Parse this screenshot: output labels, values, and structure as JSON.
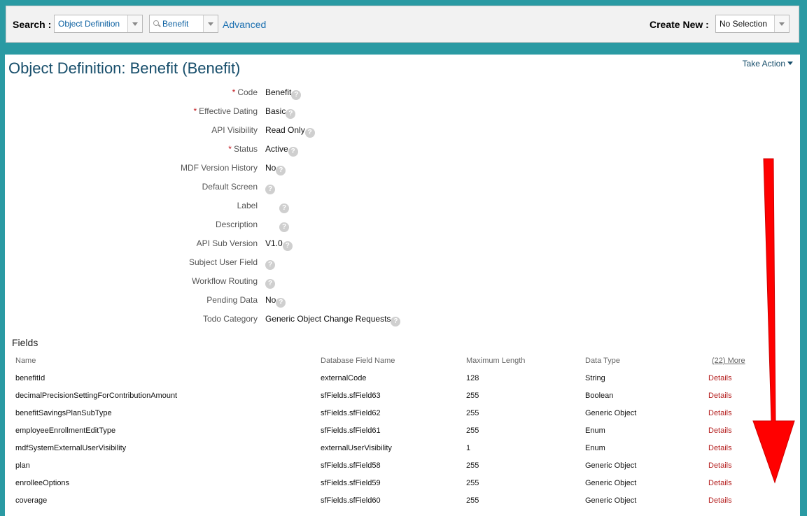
{
  "search": {
    "label": "Search :",
    "type_select": "Object Definition",
    "value_select": "Benefit",
    "advanced": "Advanced"
  },
  "create_new": {
    "label": "Create New :",
    "select": "No Selection"
  },
  "page": {
    "title": "Object Definition: Benefit (Benefit)",
    "take_action": "Take Action"
  },
  "properties": [
    {
      "label": "Code",
      "required": true,
      "value": "Benefit"
    },
    {
      "label": "Effective Dating",
      "required": true,
      "value": "Basic"
    },
    {
      "label": "API Visibility",
      "required": false,
      "value": "Read Only"
    },
    {
      "label": "Status",
      "required": true,
      "value": "Active"
    },
    {
      "label": "MDF Version History",
      "required": false,
      "value": "No"
    },
    {
      "label": "Default Screen",
      "required": false,
      "value": ""
    },
    {
      "label": "Label",
      "required": false,
      "value": ""
    },
    {
      "label": "Description",
      "required": false,
      "value": ""
    },
    {
      "label": "API Sub Version",
      "required": false,
      "value": "V1.0"
    },
    {
      "label": "Subject User Field",
      "required": false,
      "value": ""
    },
    {
      "label": "Workflow Routing",
      "required": false,
      "value": ""
    },
    {
      "label": "Pending Data",
      "required": false,
      "value": "No"
    },
    {
      "label": "Todo Category",
      "required": false,
      "value": "Generic Object Change Requests"
    }
  ],
  "fields": {
    "title": "Fields",
    "columns": [
      "Name",
      "Database Field Name",
      "Maximum Length",
      "Data Type"
    ],
    "more": "(22) More",
    "rows": [
      {
        "name": "benefitId",
        "db": "externalCode",
        "max": "128",
        "type": "String",
        "action": "Details"
      },
      {
        "name": "decimalPrecisionSettingForContributionAmount",
        "db": "sfFields.sfField63",
        "max": "255",
        "type": "Boolean",
        "action": "Details"
      },
      {
        "name": "benefitSavingsPlanSubType",
        "db": "sfFields.sfField62",
        "max": "255",
        "type": "Generic Object",
        "action": "Details"
      },
      {
        "name": "employeeEnrollmentEditType",
        "db": "sfFields.sfField61",
        "max": "255",
        "type": "Enum",
        "action": "Details"
      },
      {
        "name": "mdfSystemExternalUserVisibility",
        "db": "externalUserVisibility",
        "max": "1",
        "type": "Enum",
        "action": "Details"
      },
      {
        "name": "plan",
        "db": "sfFields.sfField58",
        "max": "255",
        "type": "Generic Object",
        "action": "Details"
      },
      {
        "name": "enrolleeOptions",
        "db": "sfFields.sfField59",
        "max": "255",
        "type": "Generic Object",
        "action": "Details"
      },
      {
        "name": "coverage",
        "db": "sfFields.sfField60",
        "max": "255",
        "type": "Generic Object",
        "action": "Details"
      }
    ]
  },
  "colors": {
    "background": "#2a9aa3",
    "title": "#174e6b",
    "required": "#c0141b",
    "details_link": "#b52020",
    "annotation_arrow": "#ff0000"
  },
  "help_icon": "?"
}
